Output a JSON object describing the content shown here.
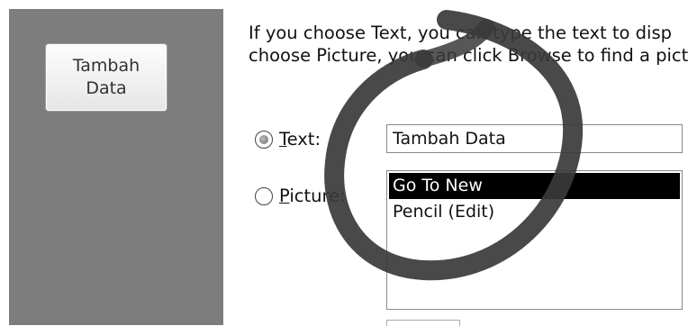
{
  "preview": {
    "button_label": "Tambah Data"
  },
  "instructions": {
    "line1": "If you choose Text, you can type the text to disp",
    "line2": "choose Picture, you can click Browse to find a pict"
  },
  "options": {
    "text_radio": {
      "mnemonic": "T",
      "rest": "ext:",
      "selected": true
    },
    "picture_radio": {
      "mnemonic": "P",
      "rest": "icture:",
      "selected": false
    }
  },
  "text_field": {
    "value": "Tambah Data"
  },
  "picture_list": {
    "items": [
      "Go To New",
      "Pencil (Edit)"
    ],
    "selected_index": 0
  },
  "annotation": {
    "color": "#3a3a3a",
    "shape": "hand-drawn-circle"
  }
}
